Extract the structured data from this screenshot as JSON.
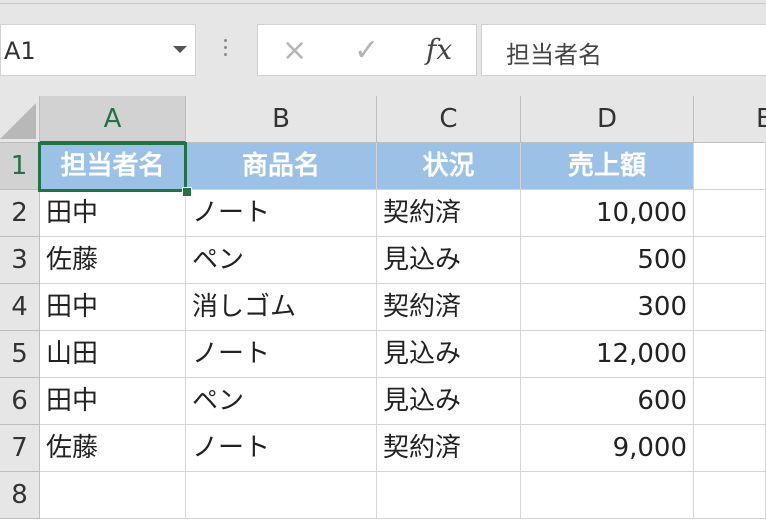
{
  "formula_bar": {
    "name_box": "A1",
    "cancel_icon": "×",
    "enter_icon": "✓",
    "fx_label": "fx",
    "formula_text": "担当者名"
  },
  "columns": [
    "A",
    "B",
    "C",
    "D",
    "E"
  ],
  "rows": [
    "1",
    "2",
    "3",
    "4",
    "5",
    "6",
    "7",
    "8"
  ],
  "table": {
    "headers": [
      "担当者名",
      "商品名",
      "状況",
      "売上額"
    ],
    "rows": [
      [
        "田中",
        "ノート",
        "契約済",
        "10,000"
      ],
      [
        "佐藤",
        "ペン",
        "見込み",
        "500"
      ],
      [
        "田中",
        "消しゴム",
        "契約済",
        "300"
      ],
      [
        "山田",
        "ノート",
        "見込み",
        "12,000"
      ],
      [
        "田中",
        "ペン",
        "見込み",
        "600"
      ],
      [
        "佐藤",
        "ノート",
        "契約済",
        "9,000"
      ]
    ]
  },
  "colors": {
    "header_fill": "#9bc2e6",
    "selection": "#217346"
  }
}
